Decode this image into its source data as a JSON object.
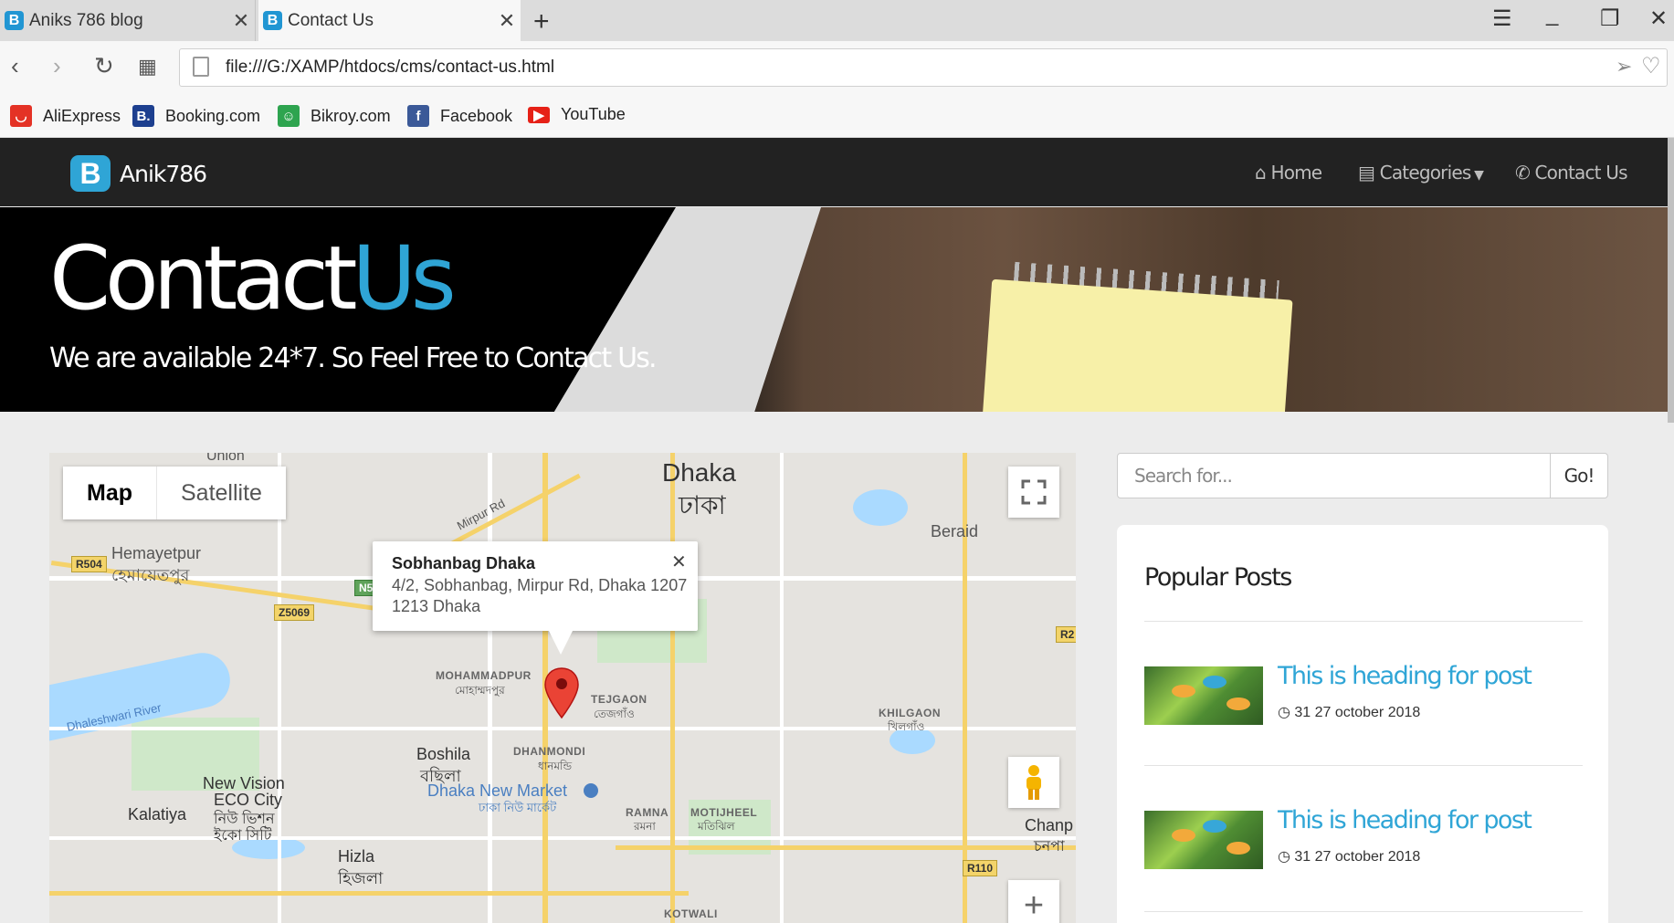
{
  "browser": {
    "tabs": [
      {
        "title": "Aniks 786 blog",
        "active": false
      },
      {
        "title": "Contact Us",
        "active": true
      }
    ],
    "url": "file:///G:/XAMP/htdocs/cms/contact-us.html",
    "bookmarks": [
      {
        "label": "AliExpress",
        "icon": "aliexpress-icon",
        "color": "#e43225"
      },
      {
        "label": "Booking.com",
        "icon": "booking-icon",
        "color": "#1d3f8f"
      },
      {
        "label": "Bikroy.com",
        "icon": "bikroy-icon",
        "color": "#2ea44f"
      },
      {
        "label": "Facebook",
        "icon": "facebook-icon",
        "color": "#3b5998"
      },
      {
        "label": "YouTube",
        "icon": "youtube-icon",
        "color": "#e62117"
      }
    ]
  },
  "site": {
    "brand": "Anik786",
    "nav": {
      "home": "Home",
      "categories": "Categories",
      "contact": "Contact Us"
    },
    "accent": "#2fa5d6"
  },
  "hero": {
    "title_main": "Contact",
    "title_accent": "Us",
    "subtitle": "We are available 24*7. So Feel Free to Contact Us."
  },
  "map": {
    "map_type": {
      "map": "Map",
      "satellite": "Satellite"
    },
    "info": {
      "title": "Sobhanbag Dhaka",
      "address_line1": "4/2, Sobhanbag, Mirpur Rd, Dhaka 1207",
      "address_line2": "1213 Dhaka"
    },
    "labels": {
      "dhaka_en": "Dhaka",
      "dhaka_bn": "ঢাকা",
      "hemayetpur": "Hemayetpur",
      "hemayetpur_bn": "হেমায়েতপুর",
      "mirpur_rd": "Mirpur Rd",
      "beraid": "Beraid",
      "mohammadpur": "MOHAMMADPUR",
      "mohammadpur_bn": "মোহাম্মদপুর",
      "tejgaon": "TEJGAON",
      "tejgaon_bn": "তেজগাঁও",
      "khilgaon": "KHILGAON",
      "khilgaon_bn": "খিলগাঁও",
      "dhanmondi": "DHANMONDI",
      "dhanmondi_bn": "ধানমন্ডি",
      "boshila": "Boshila",
      "boshila_bn": "বছিলা",
      "new_market": "Dhaka New Market",
      "new_market_bn": "ঢাকা নিউ মার্কেট",
      "new_vision": "New Vision",
      "eco_city": "ECO City",
      "new_vision_bn": "নিউ ভিশন",
      "eco_city_bn": "ইকো সিটি",
      "kalatiya": "Kalatiya",
      "ramna": "RAMNA",
      "ramna_bn": "রমনা",
      "motijheel": "MOTIJHEEL",
      "motijheel_bn": "মতিঝিল",
      "hizla": "Hizla",
      "hizla_bn": "হিজলা",
      "kotwali": "KOTWALI",
      "champ": "Chanp",
      "champ_bn": "চনপা",
      "river": "Dhaleshwari River",
      "union": "Union"
    },
    "shields": {
      "r504": "R504",
      "z5069": "Z5069",
      "r110": "R110",
      "n5": "N5",
      "r2": "R2"
    }
  },
  "sidebar": {
    "search_placeholder": "Search for...",
    "search_button": "Go!",
    "popular_title": "Popular Posts",
    "posts": [
      {
        "heading": "This is heading for post",
        "date": "31 27 october 2018"
      },
      {
        "heading": "This is heading for post",
        "date": "31 27 october 2018"
      }
    ]
  }
}
